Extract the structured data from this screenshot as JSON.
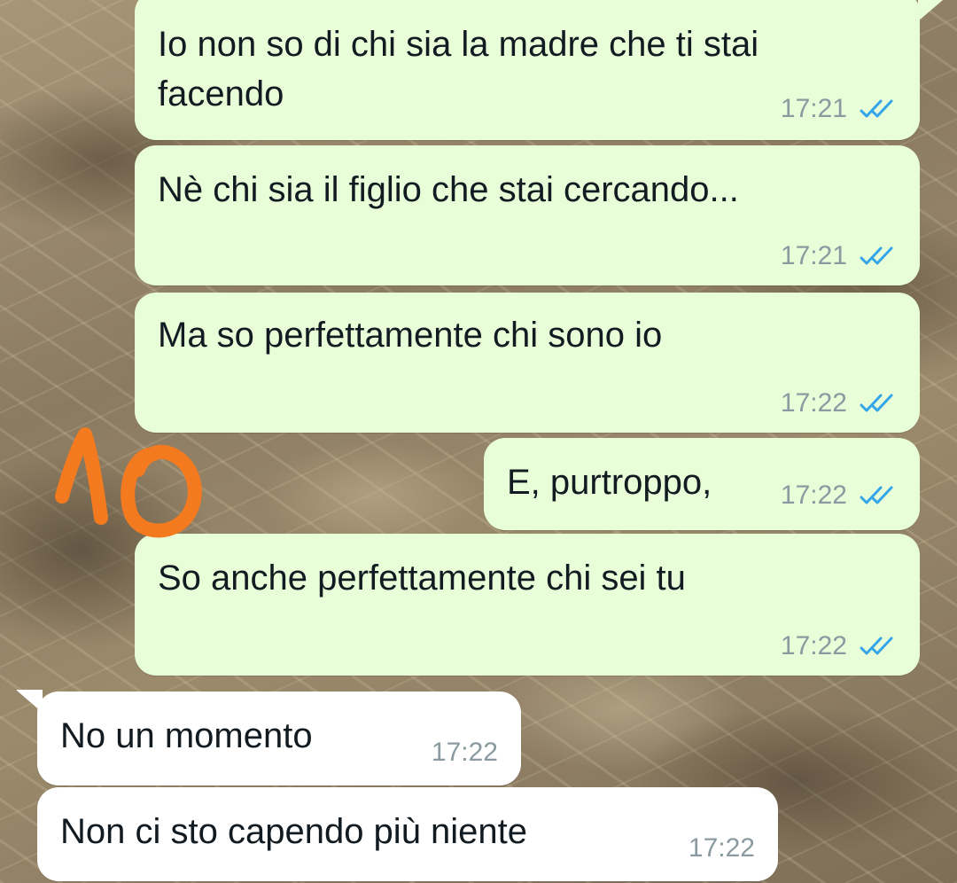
{
  "chat": {
    "messages": [
      {
        "text": "Io non so di chi sia la madre che ti stai\nfacendo",
        "time": "17:21",
        "direction": "outgoing",
        "status": "read-ticks-icon"
      },
      {
        "text": "Nè chi sia il figlio che stai cercando...",
        "time": "17:21",
        "direction": "outgoing",
        "status": "read-ticks-icon"
      },
      {
        "text": "Ma so perfettamente chi sono io",
        "time": "17:22",
        "direction": "outgoing",
        "status": "read-ticks-icon"
      },
      {
        "text": "E, purtroppo,",
        "time": "17:22",
        "direction": "outgoing",
        "status": "read-ticks-icon"
      },
      {
        "text": "So anche perfettamente chi sei tu",
        "time": "17:22",
        "direction": "outgoing",
        "status": "read-ticks-icon"
      },
      {
        "text": "No un momento",
        "time": "17:22",
        "direction": "incoming"
      },
      {
        "text": "Non ci sto capendo più niente",
        "time": "17:22",
        "direction": "incoming"
      }
    ]
  },
  "annotation": {
    "text": "10",
    "color": "#f47a1f"
  },
  "colors": {
    "outgoing_bubble": "#e7fed9",
    "incoming_bubble": "#ffffff",
    "read_ticks": "#34a5e8",
    "timestamp": "#8a9aa0"
  }
}
